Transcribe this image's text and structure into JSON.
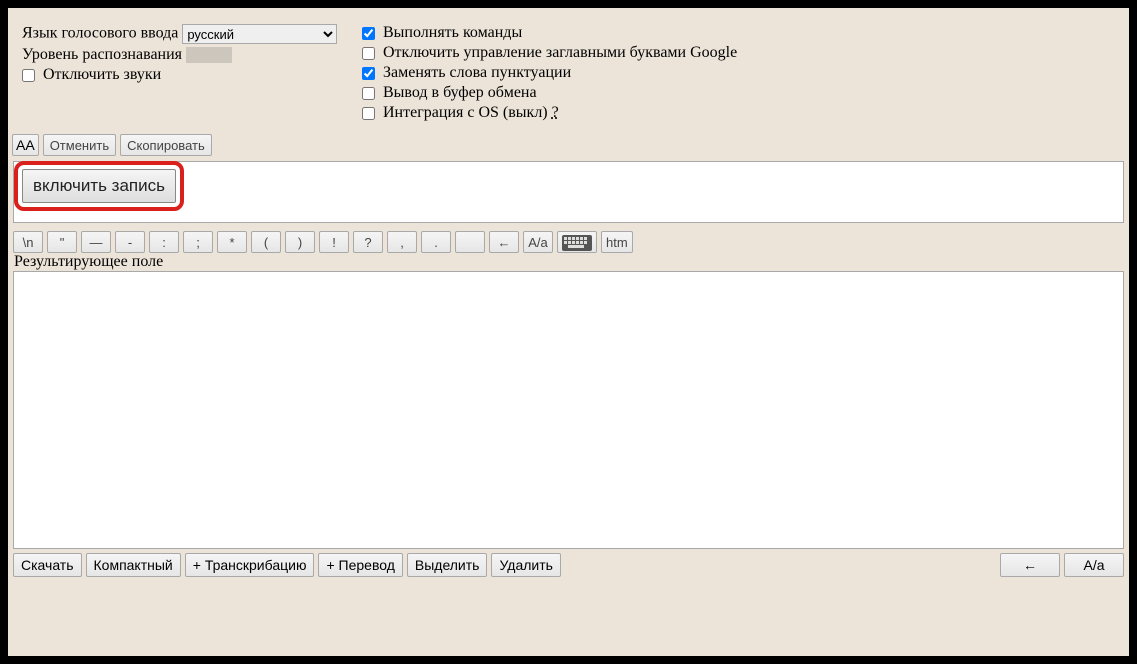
{
  "settings": {
    "lang_label": "Язык голосового ввода",
    "lang_value": "русский",
    "level_label": "Уровень распознавания",
    "mute_label": "Отключить звуки",
    "mute_checked": false,
    "opts": [
      {
        "label": "Выполнять команды",
        "checked": true
      },
      {
        "label": "Отключить управление заглавными буквами Google",
        "checked": false
      },
      {
        "label": "Заменять слова пунктуации",
        "checked": true
      },
      {
        "label": "Вывод в буфер обмена",
        "checked": false
      },
      {
        "label": "Интеграция с OS (выкл)",
        "checked": false,
        "help": "?"
      }
    ]
  },
  "toolbar1": {
    "aa": "AA",
    "undo": "Отменить",
    "copy": "Скопировать"
  },
  "record": {
    "label": "включить запись"
  },
  "punct": [
    "\\n",
    "\"",
    "—",
    "-",
    ":",
    ";",
    "*",
    "(",
    ")",
    "!",
    "?",
    ",",
    ".",
    "",
    "←",
    "A/a"
  ],
  "punct_kbd": "⌨",
  "punct_htm": "htm",
  "result_label": "Результирующее поле",
  "bottom": {
    "left": [
      "Скачать",
      "Компактный",
      "+ Транскрибацию",
      "+ Перевод",
      "Выделить",
      "Удалить"
    ],
    "right": [
      "←",
      "A/a"
    ]
  }
}
